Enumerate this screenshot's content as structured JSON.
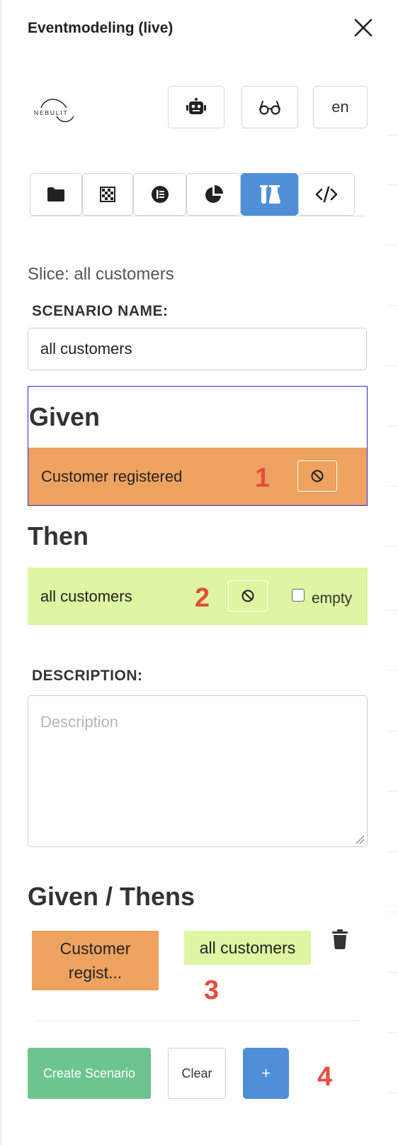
{
  "header": {
    "title": "Eventmodeling (live)"
  },
  "brand": {
    "logo_text": "NEBULIT"
  },
  "toolbar": {
    "lang_label": "en"
  },
  "tabs": [
    {
      "icon": "folder-icon",
      "active": false
    },
    {
      "icon": "checkerboard-icon",
      "active": false
    },
    {
      "icon": "list-circle-icon",
      "active": false
    },
    {
      "icon": "pie-chart-icon",
      "active": false
    },
    {
      "icon": "flask-icon",
      "active": true
    },
    {
      "icon": "code-icon",
      "active": false
    }
  ],
  "slice": {
    "label": "Slice: all customers"
  },
  "scenario": {
    "name_label": "SCENARIO NAME:",
    "name_value": "all customers",
    "given_title": "Given",
    "given_event": "Customer registered",
    "given_marker": "1",
    "then_title": "Then",
    "then_readmodel": "all customers",
    "then_marker": "2",
    "empty_label": "empty",
    "empty_checked": false,
    "description_label": "DESCRIPTION:",
    "description_placeholder": "Description",
    "description_value": ""
  },
  "given_thens": {
    "title": "Given / Thens",
    "event_card": "Customer regist...",
    "readmodel_card": "all customers",
    "marker": "3"
  },
  "actions": {
    "create_label": "Create Scenario",
    "clear_label": "Clear",
    "add_label": "+",
    "marker": "4"
  },
  "colors": {
    "event": "#eea25f",
    "readmodel": "#def5a1",
    "primary": "#4f8fd8",
    "success": "#6ec48f",
    "marker": "#e84c3d"
  }
}
